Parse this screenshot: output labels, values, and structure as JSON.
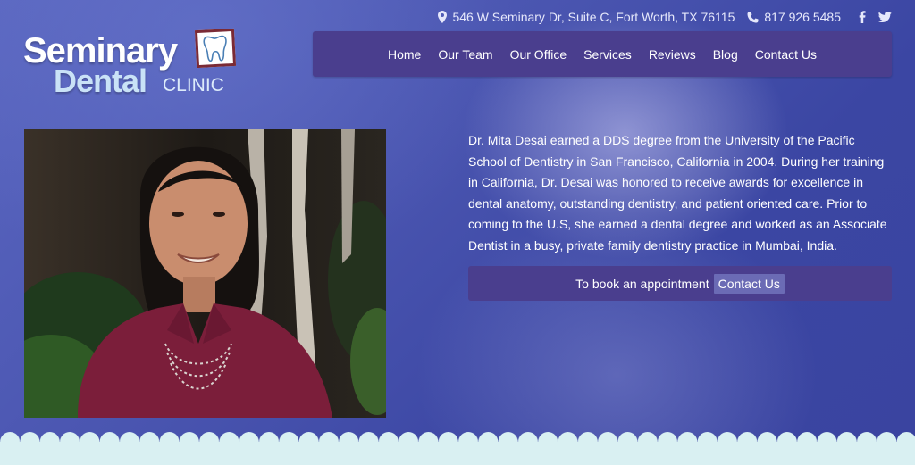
{
  "topbar": {
    "address": "546 W Seminary Dr, Suite C, Fort Worth, TX 76115",
    "phone": "817 926 5485",
    "social": [
      "facebook-icon",
      "twitter-icon"
    ]
  },
  "logo": {
    "line1": "Seminary",
    "line2": "Dental",
    "line3": "CLINIC"
  },
  "nav": {
    "items": [
      {
        "label": "Home"
      },
      {
        "label": "Our Team"
      },
      {
        "label": "Our Office"
      },
      {
        "label": "Services"
      },
      {
        "label": "Reviews"
      },
      {
        "label": "Blog"
      },
      {
        "label": "Contact Us"
      }
    ]
  },
  "bio": {
    "text": "Dr. Mita Desai earned a DDS degree from the University of the Pacific School of Dentistry in San Francisco, California in 2004. During her training in California, Dr. Desai was honored to receive awards for excellence in dental anatomy, outstanding dentistry, and patient oriented care. Prior to coming to the U.S, she earned a dental degree and worked as an Associate Dentist in a busy, private family dentistry practice in Mumbai, India."
  },
  "cta": {
    "text": "To book an appointment",
    "link": "Contact Us"
  },
  "colors": {
    "background": "#4a55b0",
    "nav_bg": "#4a3e8e",
    "cta_link_bg": "#6b6bb5",
    "scallop": "#d9f0f2"
  }
}
